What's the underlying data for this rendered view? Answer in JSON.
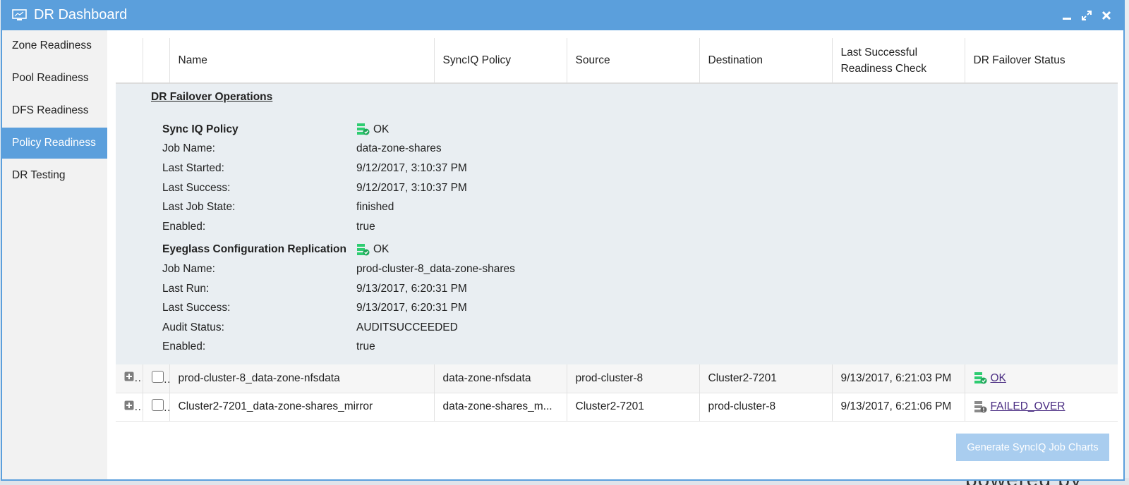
{
  "window": {
    "title": "DR Dashboard"
  },
  "sidebar": {
    "items": [
      {
        "label": "Zone Readiness"
      },
      {
        "label": "Pool Readiness"
      },
      {
        "label": "DFS Readiness"
      },
      {
        "label": "Policy Readiness"
      },
      {
        "label": "DR Testing"
      }
    ],
    "active_index": 3
  },
  "table": {
    "columns": [
      "Name",
      "SyncIQ Policy",
      "Source",
      "Destination",
      "Last Successful Readiness Check",
      "DR Failover Status"
    ],
    "rows": [
      {
        "name": "prod-cluster-8_data-zone-nfsdata",
        "policy": "data-zone-nfsdata",
        "source": "prod-cluster-8",
        "destination": "Cluster2-7201",
        "last_check": "9/13/2017, 6:21:03 PM",
        "status": "OK"
      },
      {
        "name": "Cluster2-7201_data-zone-shares_mirror",
        "policy": "data-zone-shares_m...",
        "source": "Cluster2-7201",
        "destination": "prod-cluster-8",
        "last_check": "9/13/2017, 6:21:06 PM",
        "status": "FAILED_OVER"
      }
    ]
  },
  "details": {
    "title": "DR Failover Operations",
    "syncinfo": {
      "heading": "Sync IQ Policy",
      "status": "OK",
      "fields": [
        {
          "label": "Job Name:",
          "value": "data-zone-shares"
        },
        {
          "label": "Last Started:",
          "value": "9/12/2017, 3:10:37 PM"
        },
        {
          "label": "Last Success:",
          "value": "9/12/2017, 3:10:37 PM"
        },
        {
          "label": "Last Job State:",
          "value": "finished"
        },
        {
          "label": "Enabled:",
          "value": "true"
        }
      ]
    },
    "eyeglass": {
      "heading": "Eyeglass Configuration Replication",
      "status": "OK",
      "fields": [
        {
          "label": "Job Name:",
          "value": "prod-cluster-8_data-zone-shares"
        },
        {
          "label": "Last Run:",
          "value": "9/13/2017, 6:20:31 PM"
        },
        {
          "label": "Last Success:",
          "value": "9/13/2017, 6:20:31 PM"
        },
        {
          "label": "Audit Status:",
          "value": "AUDITSUCCEEDED"
        },
        {
          "label": "Enabled:",
          "value": "true"
        }
      ]
    }
  },
  "buttons": {
    "generate": "Generate SyncIQ Job Charts"
  },
  "background": {
    "powered_text": "powered by"
  },
  "colors": {
    "accent": "#5b9fdc",
    "ok_green": "#2ecc71",
    "failed_gray": "#8a8a8a",
    "link": "#4b2e83"
  }
}
